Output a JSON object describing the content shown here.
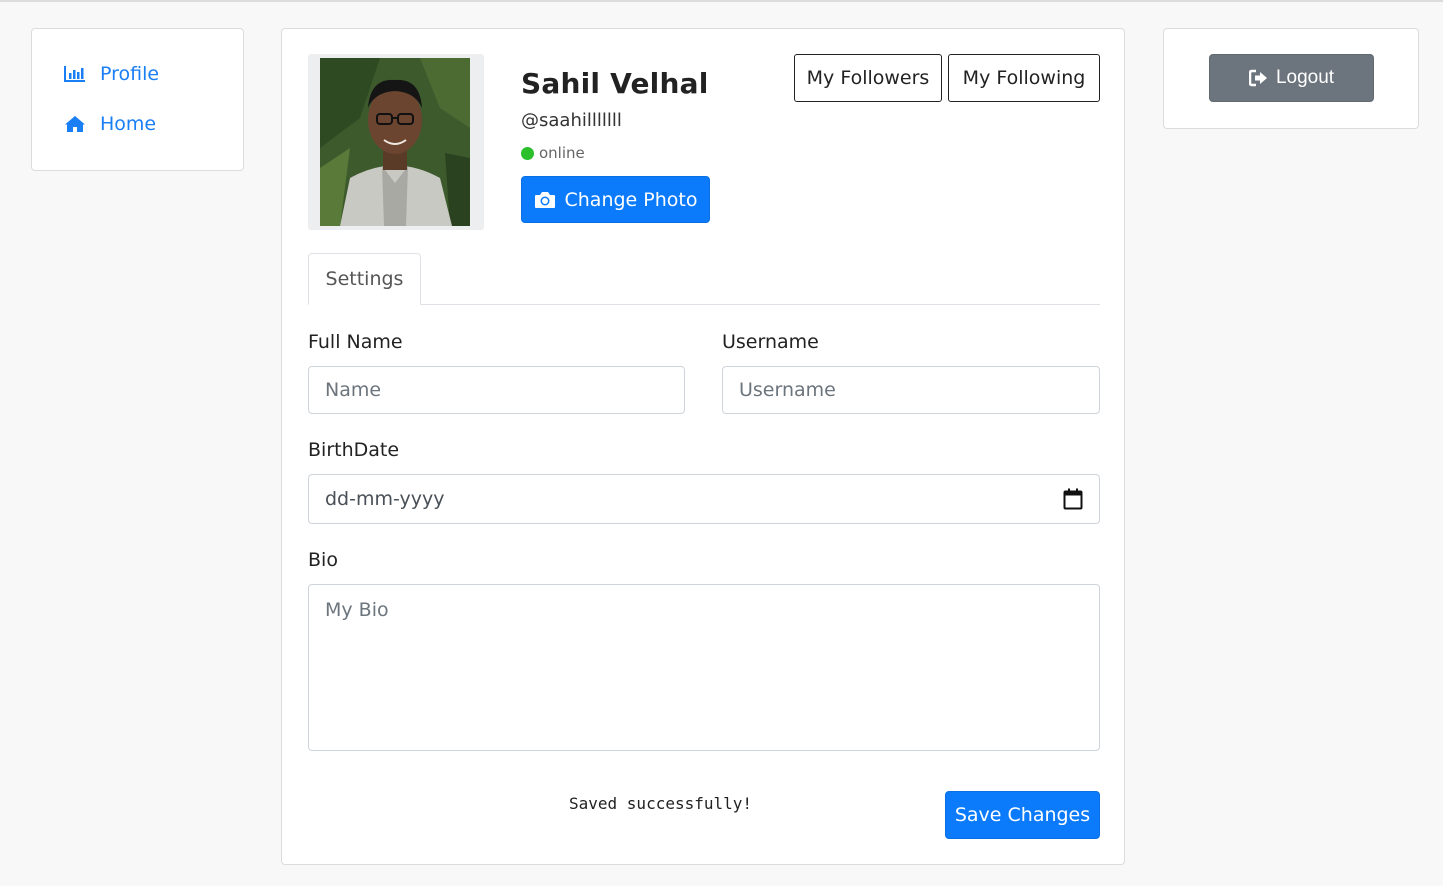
{
  "sidebar": {
    "items": [
      {
        "label": "Profile",
        "icon": "bar-chart-icon"
      },
      {
        "label": "Home",
        "icon": "home-icon"
      }
    ]
  },
  "profile": {
    "name": "Sahil Velhal",
    "handle": "@saahilllllll",
    "status": "online",
    "change_photo_label": "Change Photo",
    "followers_label": "My Followers",
    "following_label": "My Following"
  },
  "tabs": [
    {
      "label": "Settings",
      "active": true
    }
  ],
  "form": {
    "full_name_label": "Full Name",
    "name_placeholder": "Name",
    "username_label": "Username",
    "username_placeholder": "Username",
    "birthdate_label": "BirthDate",
    "birthdate_placeholder": "dd-mm-yyyy",
    "bio_label": "Bio",
    "bio_placeholder": "My Bio",
    "saved_message": "Saved successfully!",
    "save_label": "Save Changes"
  },
  "logout_label": "Logout",
  "colors": {
    "accent": "#0b7bfb",
    "link": "#1a7ef4",
    "online": "#2bc02b",
    "logout": "#6c757d"
  }
}
